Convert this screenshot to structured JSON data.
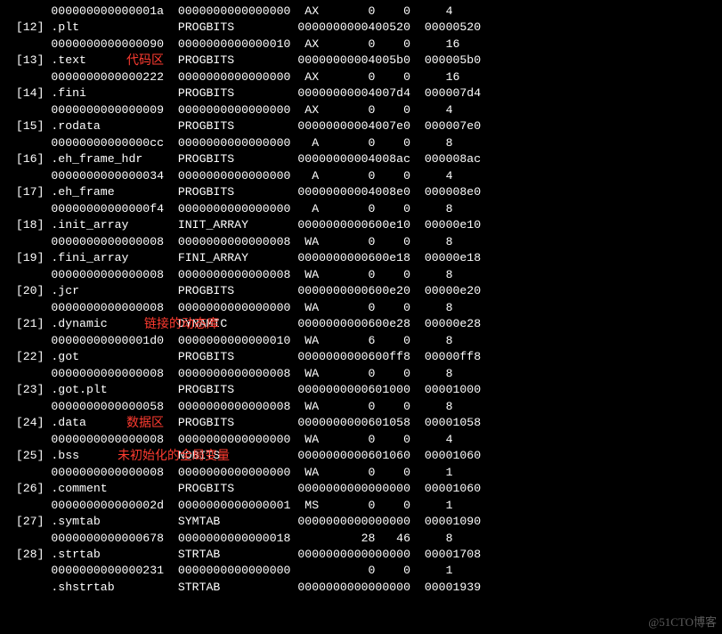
{
  "sections": [
    {
      "idx": "",
      "name": "",
      "type": "",
      "addr": "",
      "off": "",
      "size": "000000000000001a",
      "ent": "0000000000000000",
      "flg": "AX",
      "lk": "0",
      "inf": "0",
      "al": "4"
    },
    {
      "idx": "[12]",
      "name": ".plt",
      "type": "PROGBITS",
      "addr": "0000000000400520",
      "off": "00000520",
      "size": "0000000000000090",
      "ent": "0000000000000010",
      "flg": "AX",
      "lk": "0",
      "inf": "0",
      "al": "16"
    },
    {
      "idx": "[13]",
      "name": ".text",
      "type": "PROGBITS",
      "addr": "00000000004005b0",
      "off": "000005b0",
      "size": "0000000000000222",
      "ent": "0000000000000000",
      "flg": "AX",
      "lk": "0",
      "inf": "0",
      "al": "16"
    },
    {
      "idx": "[14]",
      "name": ".fini",
      "type": "PROGBITS",
      "addr": "00000000004007d4",
      "off": "000007d4",
      "size": "0000000000000009",
      "ent": "0000000000000000",
      "flg": "AX",
      "lk": "0",
      "inf": "0",
      "al": "4"
    },
    {
      "idx": "[15]",
      "name": ".rodata",
      "type": "PROGBITS",
      "addr": "00000000004007e0",
      "off": "000007e0",
      "size": "00000000000000cc",
      "ent": "0000000000000000",
      "flg": "A",
      "lk": "0",
      "inf": "0",
      "al": "8"
    },
    {
      "idx": "[16]",
      "name": ".eh_frame_hdr",
      "type": "PROGBITS",
      "addr": "00000000004008ac",
      "off": "000008ac",
      "size": "0000000000000034",
      "ent": "0000000000000000",
      "flg": "A",
      "lk": "0",
      "inf": "0",
      "al": "4"
    },
    {
      "idx": "[17]",
      "name": ".eh_frame",
      "type": "PROGBITS",
      "addr": "00000000004008e0",
      "off": "000008e0",
      "size": "00000000000000f4",
      "ent": "0000000000000000",
      "flg": "A",
      "lk": "0",
      "inf": "0",
      "al": "8"
    },
    {
      "idx": "[18]",
      "name": ".init_array",
      "type": "INIT_ARRAY",
      "addr": "0000000000600e10",
      "off": "00000e10",
      "size": "0000000000000008",
      "ent": "0000000000000008",
      "flg": "WA",
      "lk": "0",
      "inf": "0",
      "al": "8"
    },
    {
      "idx": "[19]",
      "name": ".fini_array",
      "type": "FINI_ARRAY",
      "addr": "0000000000600e18",
      "off": "00000e18",
      "size": "0000000000000008",
      "ent": "0000000000000008",
      "flg": "WA",
      "lk": "0",
      "inf": "0",
      "al": "8"
    },
    {
      "idx": "[20]",
      "name": ".jcr",
      "type": "PROGBITS",
      "addr": "0000000000600e20",
      "off": "00000e20",
      "size": "0000000000000008",
      "ent": "0000000000000000",
      "flg": "WA",
      "lk": "0",
      "inf": "0",
      "al": "8"
    },
    {
      "idx": "[21]",
      "name": ".dynamic",
      "type": "DYNAMIC",
      "addr": "0000000000600e28",
      "off": "00000e28",
      "size": "00000000000001d0",
      "ent": "0000000000000010",
      "flg": "WA",
      "lk": "6",
      "inf": "0",
      "al": "8"
    },
    {
      "idx": "[22]",
      "name": ".got",
      "type": "PROGBITS",
      "addr": "0000000000600ff8",
      "off": "00000ff8",
      "size": "0000000000000008",
      "ent": "0000000000000008",
      "flg": "WA",
      "lk": "0",
      "inf": "0",
      "al": "8"
    },
    {
      "idx": "[23]",
      "name": ".got.plt",
      "type": "PROGBITS",
      "addr": "0000000000601000",
      "off": "00001000",
      "size": "0000000000000058",
      "ent": "0000000000000008",
      "flg": "WA",
      "lk": "0",
      "inf": "0",
      "al": "8"
    },
    {
      "idx": "[24]",
      "name": ".data",
      "type": "PROGBITS",
      "addr": "0000000000601058",
      "off": "00001058",
      "size": "0000000000000008",
      "ent": "0000000000000000",
      "flg": "WA",
      "lk": "0",
      "inf": "0",
      "al": "4"
    },
    {
      "idx": "[25]",
      "name": ".bss",
      "type": "NOBITS",
      "addr": "0000000000601060",
      "off": "00001060",
      "size": "0000000000000008",
      "ent": "0000000000000000",
      "flg": "WA",
      "lk": "0",
      "inf": "0",
      "al": "1"
    },
    {
      "idx": "[26]",
      "name": ".comment",
      "type": "PROGBITS",
      "addr": "0000000000000000",
      "off": "00001060",
      "size": "000000000000002d",
      "ent": "0000000000000001",
      "flg": "MS",
      "lk": "0",
      "inf": "0",
      "al": "1"
    },
    {
      "idx": "[27]",
      "name": ".symtab",
      "type": "SYMTAB",
      "addr": "0000000000000000",
      "off": "00001090",
      "size": "0000000000000678",
      "ent": "0000000000000018",
      "flg": "",
      "lk": "28",
      "inf": "46",
      "al": "8"
    },
    {
      "idx": "[28]",
      "name": ".strtab",
      "type": "STRTAB",
      "addr": "0000000000000000",
      "off": "00001708",
      "size": "0000000000000231",
      "ent": "0000000000000000",
      "flg": "",
      "lk": "0",
      "inf": "0",
      "al": "1"
    }
  ],
  "trailing": {
    "name_partial": ".shstrtab",
    "type": "STRTAB",
    "addr": "0000000000000000",
    "off": "00001939"
  },
  "annotations": {
    "text": "代码区",
    "dynamic": "链接的动态库",
    "data": "数据区",
    "bss": "未初始化的全局变量"
  },
  "watermark": "@51CTO博客"
}
